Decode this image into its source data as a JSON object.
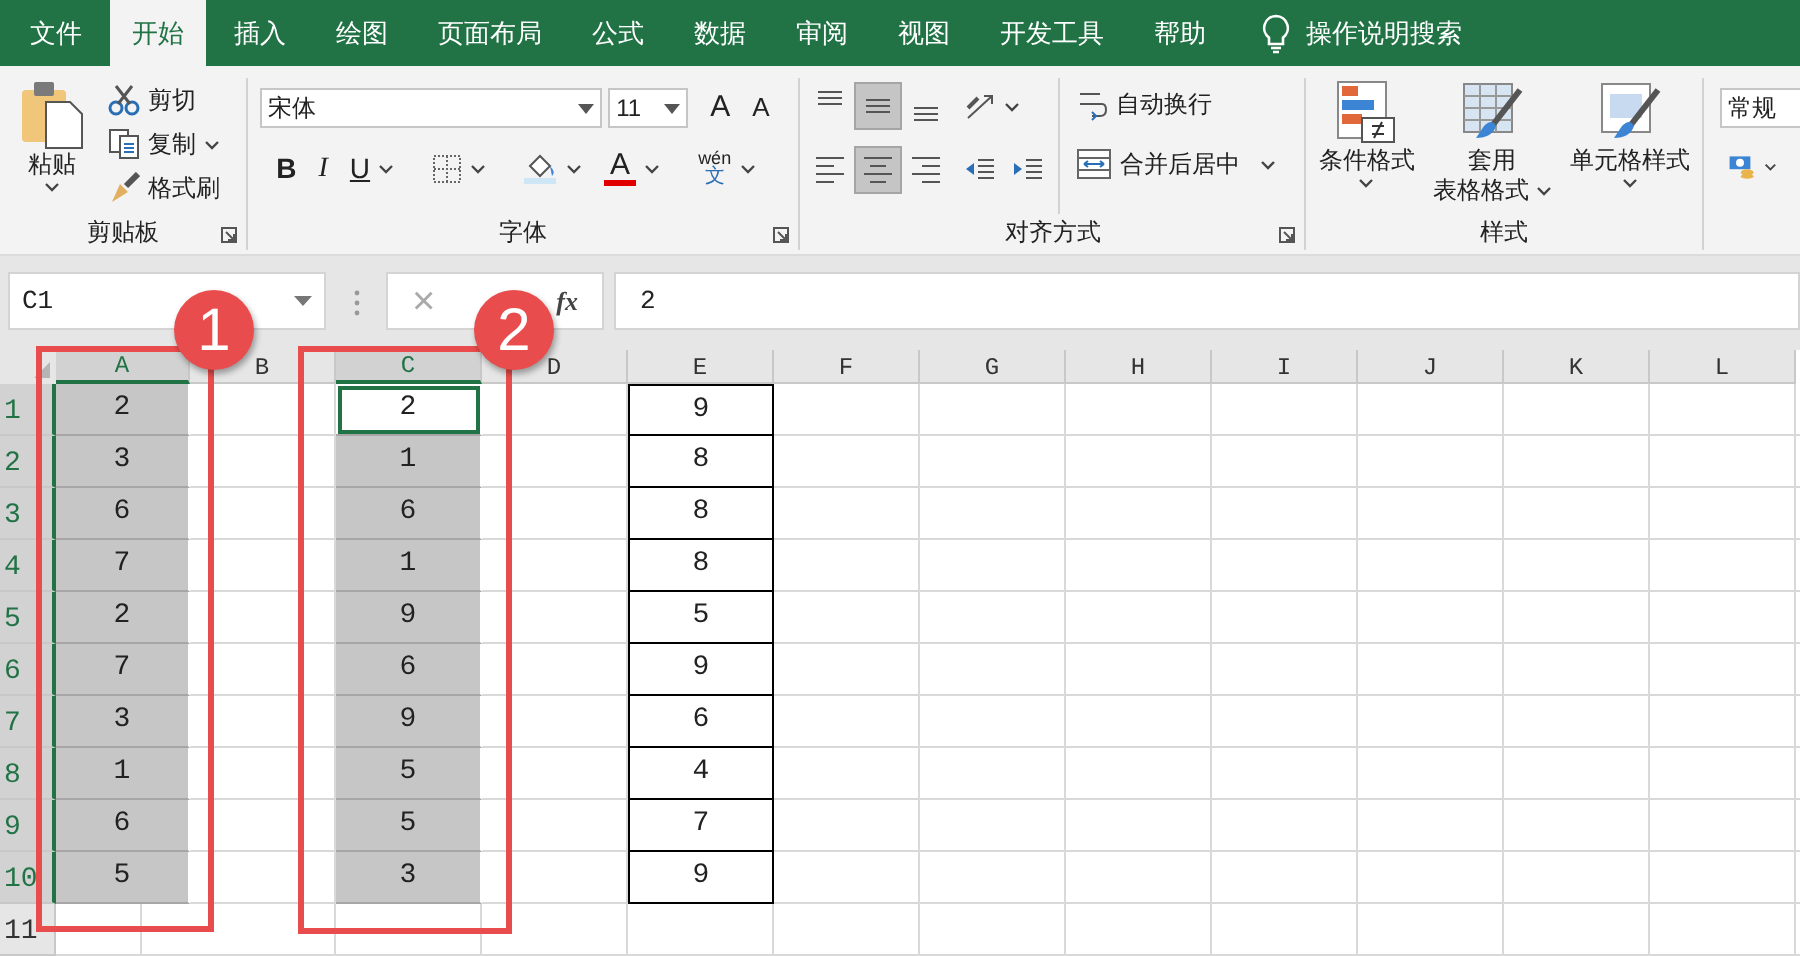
{
  "menu_tabs": [
    {
      "label": "文件",
      "selected": false
    },
    {
      "label": "开始",
      "selected": true
    },
    {
      "label": "插入",
      "selected": false
    },
    {
      "label": "绘图",
      "selected": false
    },
    {
      "label": "页面布局",
      "selected": false
    },
    {
      "label": "公式",
      "selected": false
    },
    {
      "label": "数据",
      "selected": false
    },
    {
      "label": "审阅",
      "selected": false
    },
    {
      "label": "视图",
      "selected": false
    },
    {
      "label": "开发工具",
      "selected": false
    },
    {
      "label": "帮助",
      "selected": false
    }
  ],
  "tell_me": "操作说明搜索",
  "ribbon": {
    "clipboard": {
      "paste": "粘贴",
      "cut": "剪切",
      "copy": "复制",
      "format_painter": "格式刷",
      "label": "剪贴板"
    },
    "font": {
      "font_name": "宋体",
      "font_size": "11",
      "grow_font": "A",
      "shrink_font": "A",
      "bold": "B",
      "italic": "I",
      "underline": "U",
      "font_color": "A",
      "phonetic_guide": [
        "wén",
        "文"
      ],
      "label": "字体"
    },
    "alignment": {
      "buttons": [
        {
          "kind": "top",
          "selected": false
        },
        {
          "kind": "middle",
          "selected": true
        },
        {
          "kind": "bottom",
          "selected": false
        },
        {
          "kind": "left",
          "selected": false
        },
        {
          "kind": "center",
          "selected": true
        },
        {
          "kind": "right",
          "selected": false
        }
      ],
      "wrap_text": "自动换行",
      "merge_center": "合并后居中",
      "label": "对齐方式"
    },
    "styles": {
      "conditional_formatting": "条件格式",
      "format_as_table": [
        "套用",
        "表格格式"
      ],
      "cell_styles": "单元格样式",
      "label": "样式"
    },
    "number": {
      "format": "常规"
    }
  },
  "formula_bar": {
    "name_box": "C1",
    "cancel": "×",
    "function_label": "fx",
    "formula": "2"
  },
  "sheet": {
    "columns": [
      {
        "label": "A",
        "selected": true,
        "bordered": false,
        "values": [
          {
            "text": "2",
            "active": false
          },
          {
            "text": "3",
            "active": false
          },
          {
            "text": "6",
            "active": false
          },
          {
            "text": "7",
            "active": false
          },
          {
            "text": "2",
            "active": false
          },
          {
            "text": "7",
            "active": false
          },
          {
            "text": "3",
            "active": false
          },
          {
            "text": "1",
            "active": false
          },
          {
            "text": "6",
            "active": false
          },
          {
            "text": "5",
            "active": false
          }
        ]
      },
      {
        "label": "B",
        "selected": false
      },
      {
        "label": "C",
        "selected": true,
        "bordered": false,
        "values": [
          {
            "text": "2",
            "active": true
          },
          {
            "text": "1",
            "active": false
          },
          {
            "text": "6",
            "active": false
          },
          {
            "text": "1",
            "active": false
          },
          {
            "text": "9",
            "active": false
          },
          {
            "text": "6",
            "active": false
          },
          {
            "text": "9",
            "active": false
          },
          {
            "text": "5",
            "active": false
          },
          {
            "text": "5",
            "active": false
          },
          {
            "text": "3",
            "active": false
          }
        ]
      },
      {
        "label": "D",
        "selected": false
      },
      {
        "label": "E",
        "selected": false,
        "bordered": true,
        "values": [
          {
            "text": "9",
            "active": false
          },
          {
            "text": "8",
            "active": false
          },
          {
            "text": "8",
            "active": false
          },
          {
            "text": "8",
            "active": false
          },
          {
            "text": "5",
            "active": false
          },
          {
            "text": "9",
            "active": false
          },
          {
            "text": "6",
            "active": false
          },
          {
            "text": "4",
            "active": false
          },
          {
            "text": "7",
            "active": false
          },
          {
            "text": "9",
            "active": false
          }
        ]
      },
      {
        "label": "F",
        "selected": false
      },
      {
        "label": "G",
        "selected": false
      },
      {
        "label": "H",
        "selected": false
      },
      {
        "label": "I",
        "selected": false
      },
      {
        "label": "J",
        "selected": false
      },
      {
        "label": "K",
        "selected": false
      },
      {
        "label": "L",
        "selected": false
      }
    ],
    "rows": [
      {
        "label": "1",
        "selected": true
      },
      {
        "label": "2",
        "selected": true
      },
      {
        "label": "3",
        "selected": true
      },
      {
        "label": "4",
        "selected": true
      },
      {
        "label": "5",
        "selected": true
      },
      {
        "label": "6",
        "selected": true
      },
      {
        "label": "7",
        "selected": true
      },
      {
        "label": "8",
        "selected": true
      },
      {
        "label": "9",
        "selected": true
      },
      {
        "label": "10",
        "selected": true
      },
      {
        "label": "11",
        "selected": false
      }
    ]
  },
  "annotations": [
    {
      "label": "1"
    },
    {
      "label": "2"
    }
  ]
}
